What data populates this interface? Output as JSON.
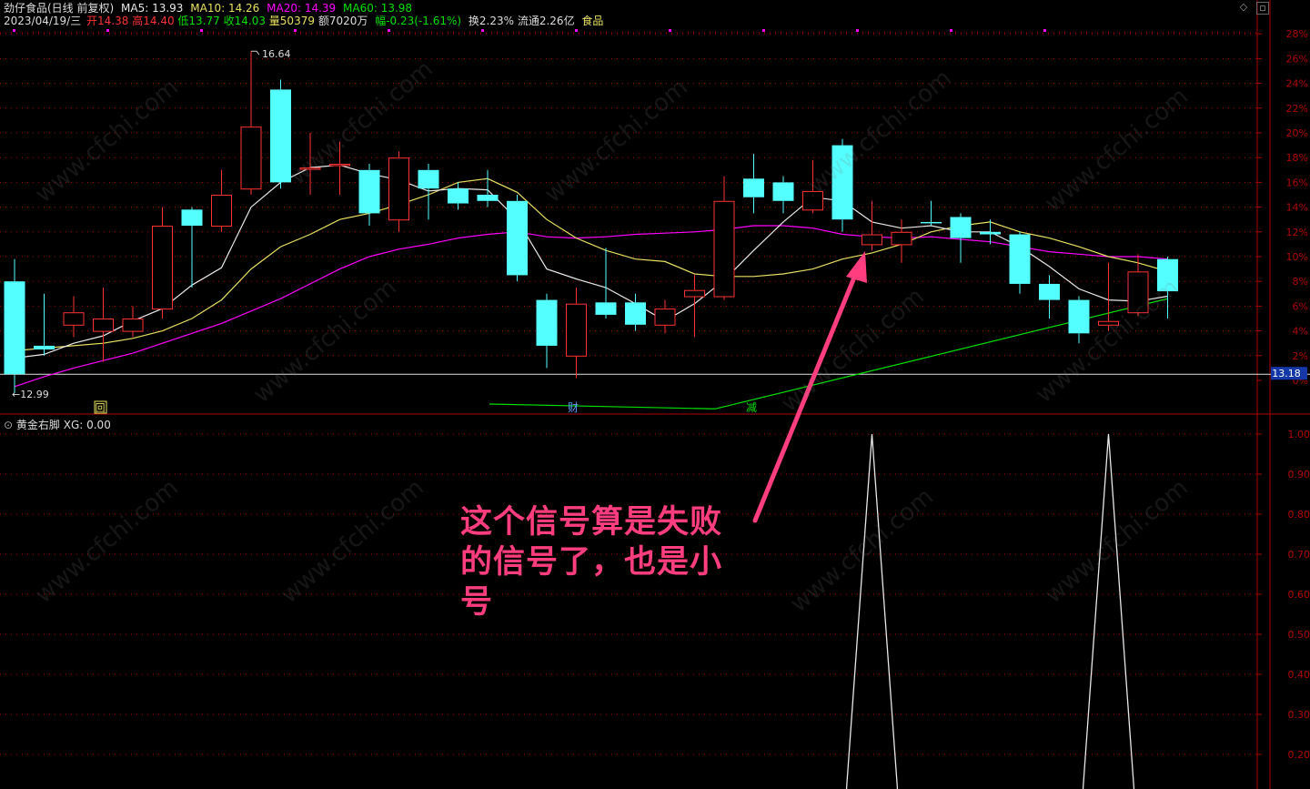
{
  "header": {
    "title": "劲仔食品(日线 前复权)",
    "ma5_label": "MA5: 13.93",
    "ma10_label": "MA10: 14.26",
    "ma20_label": "MA20: 14.39",
    "ma60_label": "MA60: 13.98",
    "date": "2023/04/19/三",
    "open": "开14.38",
    "high": "高14.40",
    "low": "低13.77",
    "close": "收14.03",
    "volume": "量50379",
    "amount": "额7020万",
    "change": "幅-0.23(-1.61%)",
    "turnover": "换2.23%",
    "float_cap": "流通2.26亿",
    "sector": "食品"
  },
  "indicator": {
    "title": "黄金右脚",
    "value_label": "XG: 0.00"
  },
  "annotation": {
    "text": "这个信号算是失败的信号了，也是小号"
  },
  "markers": {
    "high_label": "16.64",
    "low_label": "12.99",
    "current_price": "13.18",
    "event_1": "回",
    "event_2": "财",
    "event_3": "减"
  },
  "watermark": "www.cfchi.com",
  "colors": {
    "up": "#ff3232",
    "down": "#54ffff",
    "ma5": "#e8e8e8",
    "ma10": "#e8e060",
    "ma20": "#ff00ff",
    "ma60": "#00e000",
    "axis": "#b00000",
    "annotation": "#ff3d7f"
  },
  "chart_data": [
    {
      "type": "candlestick",
      "title": "劲仔食品(日线 前复权)",
      "y_ticks_percent": [
        "0%",
        "2%",
        "4%",
        "6%",
        "8%",
        "10%",
        "12%",
        "14%",
        "16%",
        "18%",
        "20%",
        "22%",
        "24%",
        "26%",
        "28%"
      ],
      "y_percent_range": [
        0,
        28
      ],
      "candles_percent": [
        {
          "o": 8.0,
          "c": 0.5,
          "h": 9.8,
          "l": -1.0
        },
        {
          "o": 2.8,
          "c": 2.5,
          "h": 7.0,
          "l": 2.0
        },
        {
          "o": 4.5,
          "c": 5.5,
          "h": 6.8,
          "l": 3.5
        },
        {
          "o": 4.0,
          "c": 5.0,
          "h": 7.5,
          "l": 1.5
        },
        {
          "o": 4.0,
          "c": 5.0,
          "h": 6.0,
          "l": 3.5
        },
        {
          "o": 5.8,
          "c": 12.5,
          "h": 14.0,
          "l": 5.0
        },
        {
          "o": 13.8,
          "c": 12.5,
          "h": 14.0,
          "l": 7.5
        },
        {
          "o": 12.5,
          "c": 15.0,
          "h": 17.0,
          "l": 12.0
        },
        {
          "o": 15.5,
          "c": 20.5,
          "h": 26.6,
          "l": 15.0
        },
        {
          "o": 23.5,
          "c": 16.0,
          "h": 24.3,
          "l": 15.5
        },
        {
          "o": 17.2,
          "c": 17.2,
          "h": 20.0,
          "l": 15.0
        },
        {
          "o": 17.5,
          "c": 17.5,
          "h": 19.3,
          "l": 15.0
        },
        {
          "o": 17.0,
          "c": 13.5,
          "h": 17.5,
          "l": 12.5
        },
        {
          "o": 13.0,
          "c": 18.0,
          "h": 18.5,
          "l": 12.0
        },
        {
          "o": 17.0,
          "c": 15.5,
          "h": 17.5,
          "l": 13.0
        },
        {
          "o": 15.5,
          "c": 14.3,
          "h": 16.0,
          "l": 13.8
        },
        {
          "o": 15.0,
          "c": 14.5,
          "h": 17.0,
          "l": 14.0
        },
        {
          "o": 14.5,
          "c": 8.5,
          "h": 15.0,
          "l": 8.0
        },
        {
          "o": 6.5,
          "c": 2.8,
          "h": 7.0,
          "l": 1.0
        },
        {
          "o": 2.0,
          "c": 6.2,
          "h": 7.5,
          "l": 0.2
        },
        {
          "o": 6.3,
          "c": 5.3,
          "h": 10.7,
          "l": 5.0
        },
        {
          "o": 6.3,
          "c": 4.5,
          "h": 7.0,
          "l": 4.0
        },
        {
          "o": 4.5,
          "c": 5.8,
          "h": 6.5,
          "l": 3.8
        },
        {
          "o": 6.8,
          "c": 7.3,
          "h": 8.5,
          "l": 3.5
        },
        {
          "o": 6.8,
          "c": 14.5,
          "h": 16.5,
          "l": 6.5
        },
        {
          "o": 16.3,
          "c": 14.8,
          "h": 18.3,
          "l": 13.5
        },
        {
          "o": 16.0,
          "c": 14.5,
          "h": 16.5,
          "l": 13.5
        },
        {
          "o": 13.8,
          "c": 15.3,
          "h": 17.8,
          "l": 13.5
        },
        {
          "o": 19.0,
          "c": 13.0,
          "h": 19.5,
          "l": 12.0
        },
        {
          "o": 11.0,
          "c": 11.8,
          "h": 14.5,
          "l": 10.5
        },
        {
          "o": 11.0,
          "c": 12.0,
          "h": 13.0,
          "l": 9.5
        },
        {
          "o": 12.8,
          "c": 12.7,
          "h": 14.5,
          "l": 12.5
        },
        {
          "o": 13.2,
          "c": 11.5,
          "h": 13.5,
          "l": 9.5
        },
        {
          "o": 12.0,
          "c": 11.8,
          "h": 13.0,
          "l": 11.0
        },
        {
          "o": 11.8,
          "c": 7.8,
          "h": 12.0,
          "l": 7.0
        },
        {
          "o": 7.8,
          "c": 6.5,
          "h": 8.5,
          "l": 5.0
        },
        {
          "o": 6.5,
          "c": 3.8,
          "h": 6.8,
          "l": 3.0
        },
        {
          "o": 4.5,
          "c": 4.8,
          "h": 9.5,
          "l": 4.0
        },
        {
          "o": 5.5,
          "c": 8.8,
          "h": 10.2,
          "l": 5.2
        },
        {
          "o": 9.8,
          "c": 7.2,
          "h": 10.0,
          "l": 5.0
        }
      ],
      "ma5_percent": [
        1.8,
        2.1,
        3.0,
        3.6,
        4.8,
        5.8,
        7.7,
        9.1,
        14.0,
        16.0,
        17.2,
        17.4,
        16.7,
        16.2,
        15.3,
        15.5,
        15.4,
        13.0,
        9.0,
        8.2,
        7.5,
        6.2,
        4.8,
        6.2,
        8.1,
        10.5,
        12.8,
        14.8,
        14.5,
        12.8,
        12.3,
        12.5,
        12.0,
        12.0,
        10.8,
        9.2,
        7.4,
        6.5,
        6.4,
        6.8
      ],
      "ma10_percent": [
        2.4,
        2.6,
        2.8,
        3.0,
        3.4,
        4.0,
        5.0,
        6.5,
        9.0,
        10.8,
        11.8,
        13.0,
        13.5,
        14.2,
        15.0,
        16.0,
        16.3,
        15.2,
        13.0,
        11.5,
        10.5,
        9.8,
        9.6,
        8.6,
        8.4,
        8.4,
        8.6,
        9.0,
        9.8,
        10.3,
        11.0,
        12.0,
        12.5,
        12.8,
        12.0,
        11.5,
        10.8,
        10.0,
        9.5,
        8.8
      ],
      "ma20_percent": [
        -0.5,
        0.3,
        1.0,
        1.6,
        2.2,
        3.0,
        3.8,
        4.6,
        5.6,
        6.6,
        7.8,
        9.0,
        10.0,
        10.6,
        11.0,
        11.5,
        11.8,
        12.0,
        11.6,
        11.5,
        11.6,
        11.8,
        11.9,
        12.0,
        12.2,
        12.5,
        12.5,
        12.3,
        11.8,
        11.6,
        11.5,
        11.6,
        11.4,
        11.2,
        10.8,
        10.4,
        10.2,
        10.0,
        10.0,
        9.8
      ],
      "ma60_segment_percent": {
        "start_index": 16,
        "start": -2.3,
        "end_index": 39,
        "end": 6.6
      },
      "reference_line_percent": 0.5
    },
    {
      "type": "line",
      "title": "黄金右脚",
      "series": [
        {
          "name": "XG",
          "values": [
            0,
            0,
            0,
            0,
            0,
            0,
            0,
            0,
            0,
            0,
            0,
            0,
            0,
            0,
            0,
            0,
            0,
            0,
            0,
            0,
            0,
            0,
            0,
            0,
            0,
            0,
            0,
            0,
            0,
            1.0,
            0,
            0,
            0,
            0,
            0,
            0,
            0,
            1.0,
            0,
            0
          ]
        }
      ],
      "y_ticks": [
        "0.20",
        "0.30",
        "0.40",
        "0.50",
        "0.60",
        "0.70",
        "0.80",
        "0.90",
        "1.00"
      ],
      "ylim": [
        0.14,
        1.0
      ]
    }
  ]
}
